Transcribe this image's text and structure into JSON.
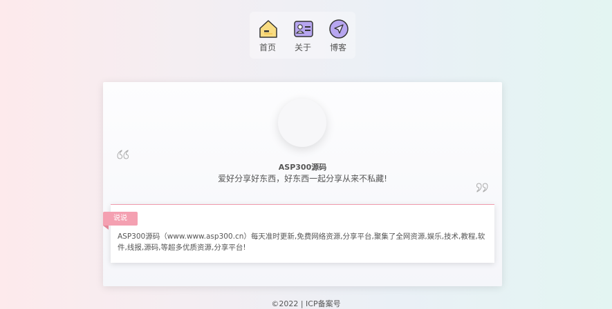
{
  "nav": {
    "items": [
      {
        "label": "首页",
        "icon": "home-icon"
      },
      {
        "label": "关于",
        "icon": "id-card-icon"
      },
      {
        "label": "博客",
        "icon": "navigation-icon"
      }
    ]
  },
  "profile": {
    "name": "ASP300源码",
    "motto": "爱好分享好东西，好东西一起分享从来不私藏!"
  },
  "sayings": {
    "tag": "说说",
    "text": "ASP300源码（www.www.asp300.cn）每天准时更新,免费网络资源,分享平台,聚集了全网资源,娱乐,技术,教程,软件,线报,源码,等超多优质资源,分享平台!"
  },
  "footer": {
    "text": "©2022 | ICP备案号"
  },
  "colors": {
    "accent_pink": "#f4a0b1",
    "divider_pink": "#f09aac",
    "icon_purple": "#b7a6f0",
    "icon_yellow": "#f8dc83"
  }
}
